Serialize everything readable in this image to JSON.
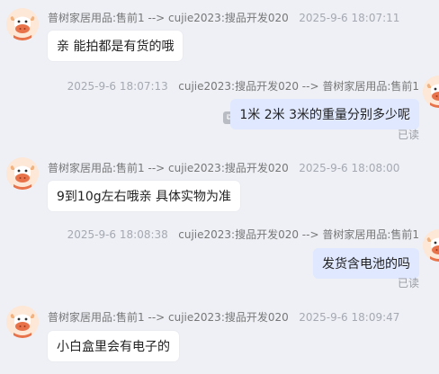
{
  "messages": [
    {
      "side": "left",
      "sender": "普树家居用品:售前1 --> cujie2023:搜品开发020",
      "time": "2025-9-6 18:07:11",
      "text": "亲 能拍都是有货的哦"
    },
    {
      "side": "right",
      "sender": "cujie2023:搜品开发020 --> 普树家居用品:售前1",
      "time": "2025-9-6 18:07:13",
      "text": "1米 2米 3米的重量分别多少呢",
      "status": "已读"
    },
    {
      "side": "left",
      "sender": "普树家居用品:售前1 --> cujie2023:搜品开发020",
      "time": "2025-9-6 18:08:00",
      "text": "9到10g左右哦亲 具体实物为准"
    },
    {
      "side": "right",
      "sender": "cujie2023:搜品开发020 --> 普树家居用品:售前1",
      "time": "2025-9-6 18:08:38",
      "text": "发货含电池的吗",
      "status": "已读"
    },
    {
      "side": "left",
      "sender": "普树家居用品:售前1 --> cujie2023:搜品开发020",
      "time": "2025-9-6 18:09:47",
      "text": "小白盒里会有电子的"
    }
  ]
}
